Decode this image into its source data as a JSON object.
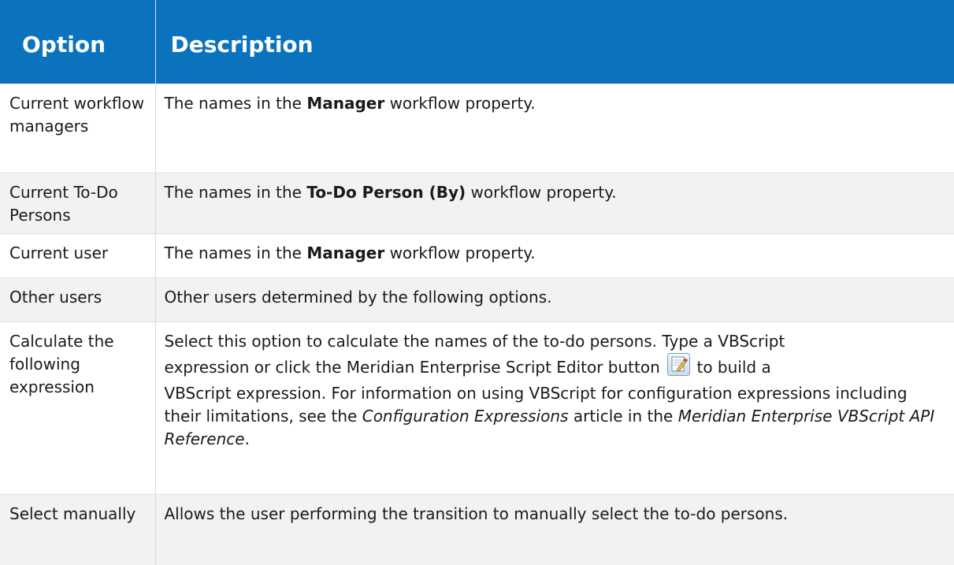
{
  "headers": {
    "option": "Option",
    "description": "Description"
  },
  "rows": [
    {
      "option": "Current workflow managers",
      "desc_before": "The names in the ",
      "desc_bold": "Manager",
      "desc_after": " workflow property."
    },
    {
      "option": "Current To-Do Persons",
      "desc_before": "The names in the ",
      "desc_bold": "To-Do Person (By)",
      "desc_after": " workflow property."
    },
    {
      "option": "Current user",
      "desc_before": "The names in the ",
      "desc_bold": "Manager",
      "desc_after": " workflow property."
    },
    {
      "option": "Other users",
      "desc": "Other users determined by the following options."
    },
    {
      "option": "Calculate the following expression",
      "desc_line1": "Select this option to calculate the names of the to-do persons. Type a VBScript",
      "desc_line2a": "expression or click the Meridian Enterprise Script Editor button ",
      "desc_line2b": " to build a",
      "desc_rest_1": "VBScript expression.  For information on using VBScript for configuration expressions including their limitations, see the ",
      "desc_italic_1": "Configuration Expressions",
      "desc_rest_2": " article in the ",
      "desc_italic_2": "Meridian Enterprise VBScript API Reference",
      "desc_rest_3": ".",
      "button_icon": "script-editor-icon"
    },
    {
      "option": "Select manually",
      "desc": "Allows the user performing the transition to manually select the to-do persons."
    }
  ],
  "colors": {
    "header_bg": "#0b73bd",
    "header_text": "#ffffff",
    "alt_row_bg": "#f2f2f2"
  }
}
